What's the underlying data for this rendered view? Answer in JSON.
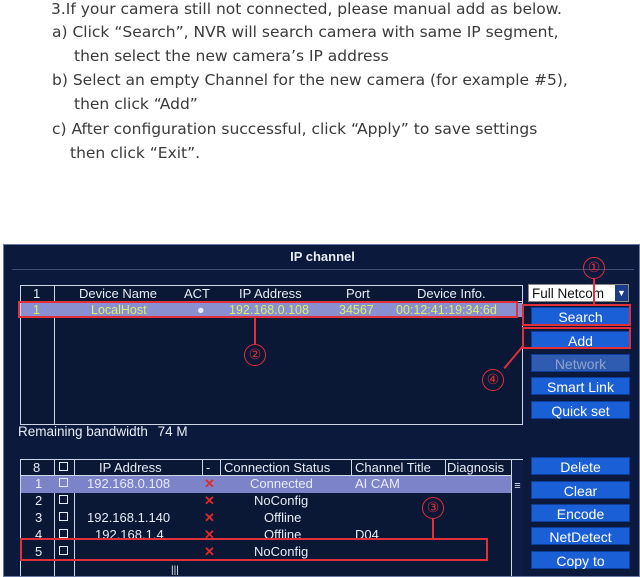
{
  "instructions": {
    "line1": "3.If your camera still not connected, please manual add as below.",
    "line2": "a) Click “Search”, NVR will search camera with same IP segment,",
    "line3": "then select the new camera’s IP address",
    "line4": "b) Select an empty Channel for the new camera (for example #5),",
    "line5": "then click “Add”",
    "line6": "c) After configuration successful, click “Apply” to save settings",
    "line7": "then click “Exit”."
  },
  "window": {
    "title": "IP channel"
  },
  "device_table": {
    "headers": [
      "1",
      "Device Name",
      "ACT",
      "IP Address",
      "Port",
      "Device Info."
    ],
    "rows": [
      {
        "idx": "1",
        "name": "LocalHost",
        "act": "●",
        "ip": "192.168.0.108",
        "port": "34567",
        "info": "00:12:41:19:34:6d"
      }
    ]
  },
  "protocol_select": {
    "value": "Full Netcom"
  },
  "side_buttons": {
    "search": "Search",
    "add": "Add",
    "network": "Network",
    "smart_link": "Smart Link",
    "quick_set": "Quick set"
  },
  "bandwidth": {
    "label": "Remaining bandwidth",
    "value": "74 M"
  },
  "channel_table": {
    "headers": [
      "8",
      "IP Address",
      "-",
      "Connection Status",
      "Channel Title",
      "Diagnosis"
    ],
    "rows": [
      {
        "ch": "1",
        "ip": "192.168.0.108",
        "x": "✕",
        "status": "Connected",
        "title": "AI CAM"
      },
      {
        "ch": "2",
        "ip": "",
        "x": "✕",
        "status": "NoConfig",
        "title": ""
      },
      {
        "ch": "3",
        "ip": "192.168.1.140",
        "x": "✕",
        "status": "Offline",
        "title": ""
      },
      {
        "ch": "4",
        "ip": "192.168.1.4",
        "x": "✕",
        "status": "Offline",
        "title": "D04"
      },
      {
        "ch": "5",
        "ip": "",
        "x": "✕",
        "status": "NoConfig",
        "title": ""
      }
    ]
  },
  "bottom_buttons": {
    "delete": "Delete",
    "clear": "Clear",
    "encode": "Encode",
    "netdetect": "NetDetect",
    "copy_to": "Copy to"
  },
  "markers": {
    "m1": "①",
    "m2": "②",
    "m3": "③",
    "m4": "④"
  },
  "colors": {
    "annotation": "#e0303a",
    "button": "#1b5fd6",
    "panel": "#0b1a3c",
    "row_highlight": "#8a8fcf"
  }
}
